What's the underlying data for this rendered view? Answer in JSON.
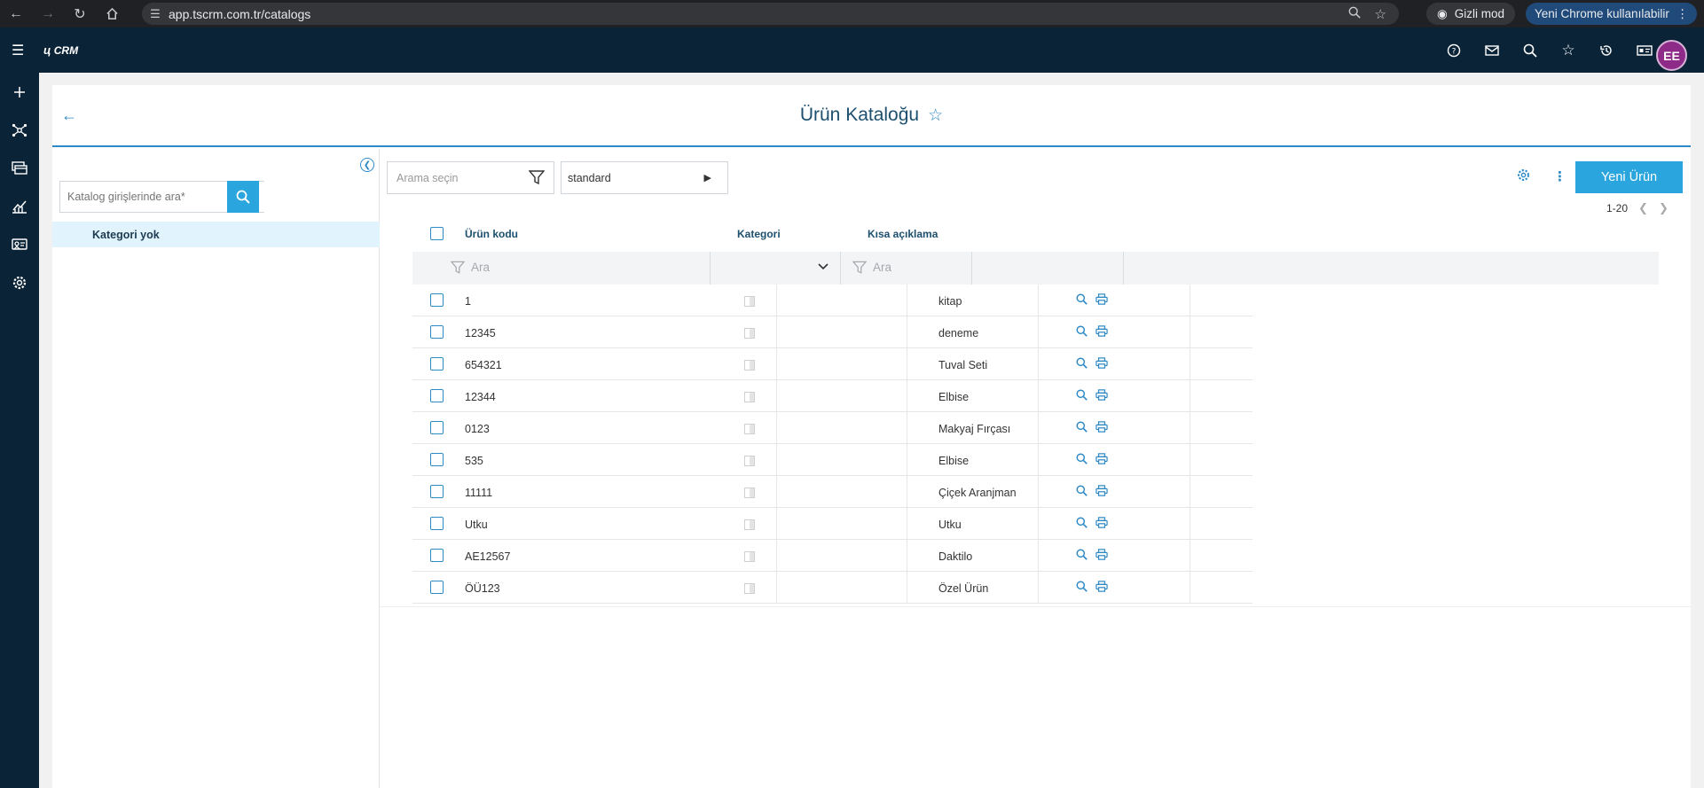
{
  "browser": {
    "url": "app.tscrm.com.tr/catalogs",
    "incognito_label": "Gizli mod",
    "new_user_label": "Yeni Chrome kullanılabilir"
  },
  "app": {
    "logo": "CRM",
    "avatar_initials": "ΕΕ"
  },
  "page": {
    "title": "Ürün Kataloğu"
  },
  "sidebar": {
    "search_placeholder": "Katalog girişlerinde ara*",
    "categories": [
      "Kategori yok"
    ]
  },
  "toolbar": {
    "search_select_placeholder": "Arama seçin",
    "view_select_value": "standard",
    "new_button": "Yeni Ürün",
    "pager_range": "1-20"
  },
  "table": {
    "columns": [
      "Ürün kodu",
      "Kategori",
      "Kısa açıklama"
    ],
    "filter_placeholder": "Ara",
    "rows": [
      {
        "code": "1",
        "desc": "kitap"
      },
      {
        "code": "12345",
        "desc": "deneme"
      },
      {
        "code": "654321",
        "desc": "Tuval Seti"
      },
      {
        "code": "12344",
        "desc": "Elbise"
      },
      {
        "code": "0123",
        "desc": "Makyaj Fırçası"
      },
      {
        "code": "535",
        "desc": "Elbise"
      },
      {
        "code": "11111",
        "desc": "Çiçek Aranjman"
      },
      {
        "code": "Utku",
        "desc": "Utku"
      },
      {
        "code": "AE12567",
        "desc": "Daktilo"
      },
      {
        "code": "ÖÜ123",
        "desc": "Özel Ürün"
      }
    ]
  },
  "colors": {
    "navy": "#0b2336",
    "accent": "#2aa5dd",
    "link": "#2d8ac7"
  }
}
